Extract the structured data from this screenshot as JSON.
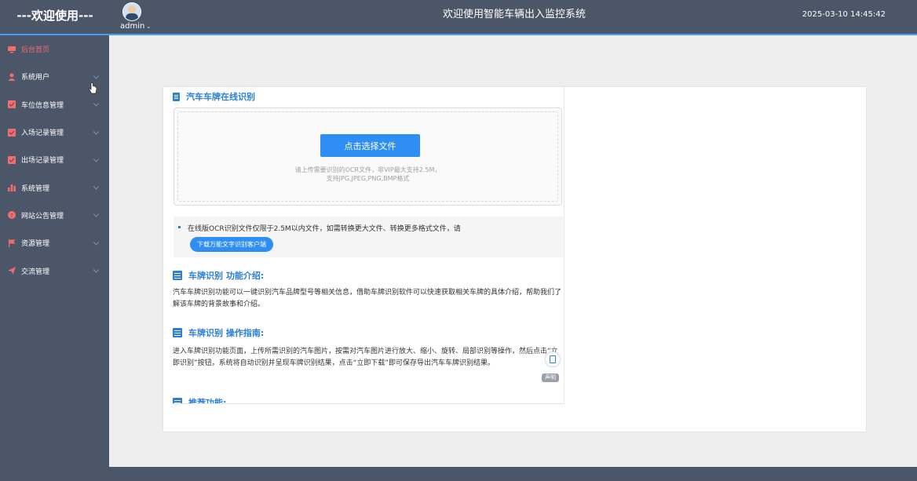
{
  "header": {
    "brand": "---欢迎使用---",
    "username": "admin",
    "user_caret": "⌄",
    "system_title": "欢迎使用智能车辆出入监控系统",
    "datetime": "2025-03-10 14:45:42"
  },
  "sidebar": {
    "items": [
      {
        "label": "后台首页",
        "icon": "monitor-icon",
        "active": true
      },
      {
        "label": "系统用户",
        "icon": "user-icon"
      },
      {
        "label": "车位信息管理",
        "icon": "check-square-icon"
      },
      {
        "label": "入场记录管理",
        "icon": "check-square-icon"
      },
      {
        "label": "出场记录管理",
        "icon": "check-square-icon"
      },
      {
        "label": "系统管理",
        "icon": "bar-chart-icon"
      },
      {
        "label": "网站公告管理",
        "icon": "question-circle-icon"
      },
      {
        "label": "资源管理",
        "icon": "flag-icon"
      },
      {
        "label": "交流管理",
        "icon": "send-icon"
      }
    ]
  },
  "ocr": {
    "section_title": "汽车车牌在线识别",
    "choose_button": "点击选择文件",
    "hint_line1": "请上传需要识别的OCR文件，非VIP最大支持2.5M，",
    "hint_line2": "支持JPG,JPEG,PNG,BMP格式",
    "tip_text": "在线版OCR识别文件仅限于2.5M以内文件，如需转换更大文件、转换更多格式文件，请",
    "download_button": "下载万能文字识别客户端",
    "intro_title": "车牌识别 功能介绍:",
    "intro_text": "汽车车牌识别功能可以一键识别汽车品牌型号等相关信息，借助车牌识别软件可以快速获取相关车牌的具体介绍，帮助我们了解该车牌的背景故事和介绍。",
    "guide_title": "车牌识别 操作指南:",
    "guide_text": "进入车牌识别功能页面，上传所需识别的汽车图片，按需对汽车图片进行放大、缩小、旋转、局部识别等操作，然后点击“立即识别”按钮，系统将自动识别并呈现车牌识别结果，点击“立即下载”即可保存导出汽车车牌识别结果。",
    "recommend_title": "推荐功能:",
    "statement_tag": "声明"
  },
  "colors": {
    "header_bg": "#4c5669",
    "accent": "#409eff",
    "button_blue": "#2f8ef3",
    "title_blue": "#2b7fd6",
    "nav_icon_red": "#f56c6c"
  }
}
